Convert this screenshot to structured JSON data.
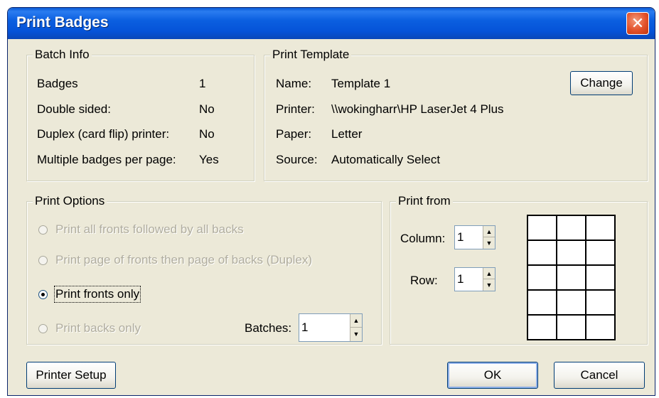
{
  "window": {
    "title": "Print Badges",
    "close_glyph": "✕"
  },
  "batch_info": {
    "legend": "Batch Info",
    "rows": [
      {
        "label": "Badges",
        "value": "1"
      },
      {
        "label": "Double sided:",
        "value": "No"
      },
      {
        "label": "Duplex (card flip) printer:",
        "value": "No"
      },
      {
        "label": "Multiple badges per page:",
        "value": "Yes"
      }
    ]
  },
  "print_template": {
    "legend": "Print Template",
    "name_label": "Name:",
    "name_value": "Template 1",
    "printer_label": "Printer:",
    "printer_value": "\\\\wokingharr\\HP LaserJet 4 Plus",
    "paper_label": "Paper:",
    "paper_value": "Letter",
    "source_label": "Source:",
    "source_value": "Automatically Select",
    "change_button": "Change"
  },
  "print_options": {
    "legend": "Print Options",
    "options": [
      {
        "label": "Print all fronts followed by all backs",
        "enabled": false,
        "selected": false
      },
      {
        "label": "Print page of fronts then page of backs (Duplex)",
        "enabled": false,
        "selected": false
      },
      {
        "label": "Print fronts only",
        "enabled": true,
        "selected": true
      },
      {
        "label": "Print backs only",
        "enabled": false,
        "selected": false
      }
    ],
    "batches_label": "Batches:",
    "batches_value": "1"
  },
  "print_from": {
    "legend": "Print from",
    "column_label": "Column:",
    "column_value": "1",
    "row_label": "Row:",
    "row_value": "1",
    "grid_rows": 5,
    "grid_cols": 3
  },
  "buttons": {
    "printer_setup": "Printer Setup",
    "ok": "OK",
    "cancel": "Cancel"
  },
  "icons": {
    "spin_up": "▲",
    "spin_down": "▼"
  },
  "colors": {
    "title_bar": "#0553d8",
    "close_button": "#e2512a",
    "dialog_bg": "#ece9d8"
  }
}
